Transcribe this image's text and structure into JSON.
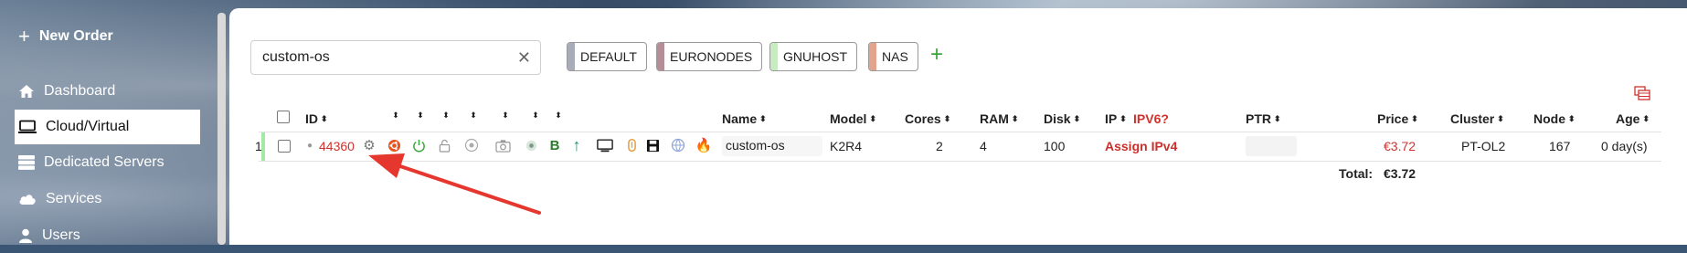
{
  "sidebar": {
    "new_order": "New Order",
    "items": [
      {
        "label": "Dashboard",
        "icon": "home-icon"
      },
      {
        "label": "Cloud/Virtual",
        "icon": "monitor-icon",
        "active": true
      },
      {
        "label": "Dedicated Servers",
        "icon": "server-icon"
      },
      {
        "label": "Services",
        "icon": "cloud-icon"
      },
      {
        "label": "Users",
        "icon": "user-icon"
      }
    ]
  },
  "search": {
    "value": "custom-os"
  },
  "tags": [
    {
      "label": "DEFAULT",
      "color": "#a8acb8"
    },
    {
      "label": "EURONODES",
      "color": "#b58d97"
    },
    {
      "label": "GNUHOST",
      "color": "#c6ecc0"
    },
    {
      "label": "NAS",
      "color": "#e2a48e"
    }
  ],
  "table": {
    "headers": {
      "id": "ID",
      "name": "Name",
      "model": "Model",
      "cores": "Cores",
      "ram": "RAM",
      "disk": "Disk",
      "ip": "IP",
      "ipv6": "IPV6?",
      "ptr": "PTR",
      "price": "Price",
      "cluster": "Cluster",
      "node": "Node",
      "age": "Age"
    },
    "row": {
      "index": "1",
      "id": "44360",
      "name": "custom-os",
      "model": "K2R4",
      "cores": "2",
      "ram": "4",
      "disk": "100",
      "ip": "Assign IPv4",
      "price": "€3.72",
      "cluster": "PT-OL2",
      "node": "167",
      "age": "0 day(s)"
    },
    "total_label": "Total:",
    "total_value": "€3.72",
    "b_label": "B"
  },
  "colors": {
    "accent_red": "#d0322d",
    "green": "#3aa53a"
  }
}
